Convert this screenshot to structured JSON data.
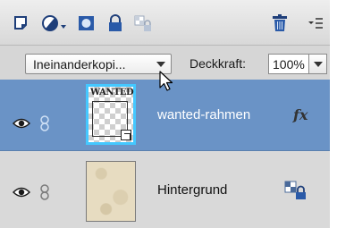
{
  "toolbar": {
    "icons": [
      "new-layer-icon",
      "adjustment-layer-icon",
      "layer-mask-icon",
      "lock-icon",
      "lock-transparent-icon",
      "trash-icon",
      "panel-menu-icon"
    ]
  },
  "blend": {
    "mode": "Ineinanderkopi...",
    "opacity_label": "Deckkraft:",
    "opacity_value": "100%"
  },
  "layers": [
    {
      "name": "wanted-rahmen",
      "selected": true,
      "fx": "fx",
      "thumb_text": "WANTED"
    },
    {
      "name": "Hintergrund",
      "selected": false
    }
  ],
  "colors": {
    "selection": "#6a93c6",
    "thumb_border": "#44c8ff",
    "panel_bg": "#d9d9d9"
  }
}
